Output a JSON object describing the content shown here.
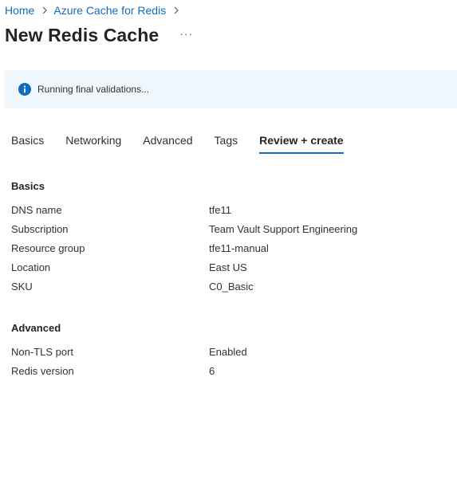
{
  "breadcrumb": {
    "items": [
      "Home",
      "Azure Cache for Redis"
    ]
  },
  "header": {
    "title": "New Redis Cache",
    "more_label": "···"
  },
  "banner": {
    "icon": "info-icon",
    "text": "Running final validations..."
  },
  "tabs": [
    {
      "label": "Basics",
      "active": false
    },
    {
      "label": "Networking",
      "active": false
    },
    {
      "label": "Advanced",
      "active": false
    },
    {
      "label": "Tags",
      "active": false
    },
    {
      "label": "Review + create",
      "active": true
    }
  ],
  "sections": {
    "basics": {
      "title": "Basics",
      "rows": [
        {
          "label": "DNS name",
          "value": "tfe11"
        },
        {
          "label": "Subscription",
          "value": "Team Vault Support Engineering"
        },
        {
          "label": "Resource group",
          "value": "tfe11-manual"
        },
        {
          "label": "Location",
          "value": "East US"
        },
        {
          "label": "SKU",
          "value": "C0_Basic"
        }
      ]
    },
    "advanced": {
      "title": "Advanced",
      "rows": [
        {
          "label": "Non-TLS port",
          "value": "Enabled"
        },
        {
          "label": "Redis version",
          "value": "6"
        }
      ]
    }
  },
  "colors": {
    "accent": "#0f6cbd",
    "banner_bg": "#eff6fc",
    "text": "#323130"
  }
}
